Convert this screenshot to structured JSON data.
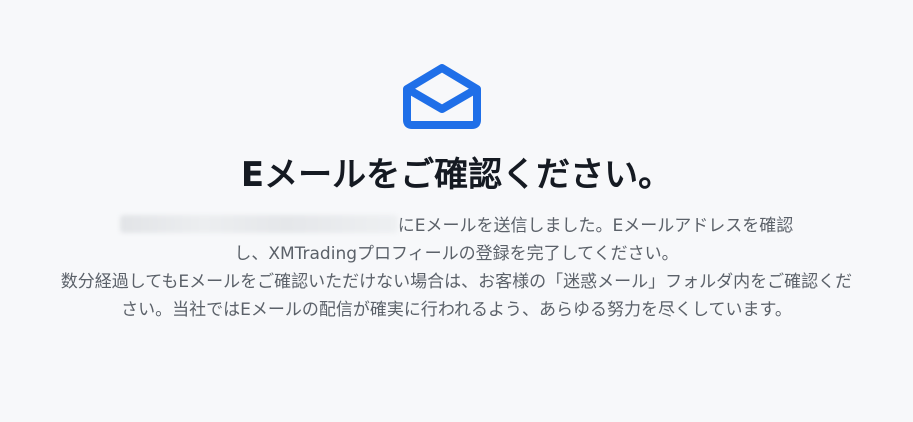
{
  "icon": {
    "name": "open-envelope-icon",
    "color": "#1f6fe8"
  },
  "title": "Eメールをご確認ください。",
  "message": {
    "line1_suffix": "にEメールを送信しました。Eメールアドレスを確認",
    "line2": "し、XMTradingプロフィールの登録を完了してください。",
    "paragraph2": "数分経過してもEメールをご確認いただけない場合は、お客様の「迷惑メール」フォルダ内をご確認ください。当社ではEメールの配信が確実に行われるよう、あらゆる努力を尽くしています。"
  }
}
